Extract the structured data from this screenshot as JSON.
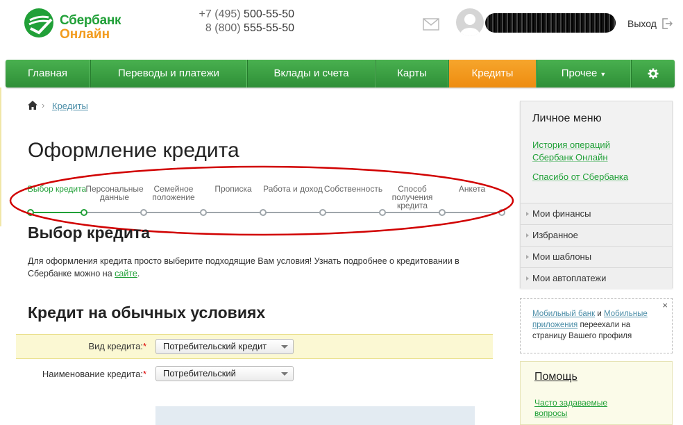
{
  "header": {
    "logo_line1": "Сбербанк",
    "logo_line2": "Онлайн",
    "phone1_prefix": "+7 (495)",
    "phone1_number": "500-55-50",
    "phone2_prefix": "8 (800)",
    "phone2_number": "555-55-50",
    "logout_label": "Выход"
  },
  "nav": {
    "items": [
      {
        "label": "Главная"
      },
      {
        "label": "Переводы и платежи"
      },
      {
        "label": "Вклады и счета"
      },
      {
        "label": "Карты"
      },
      {
        "label": "Кредиты"
      },
      {
        "label": "Прочее"
      }
    ],
    "active": "Кредиты"
  },
  "breadcrumb": {
    "item": "Кредиты"
  },
  "page_title": "Оформление кредита",
  "steps": [
    {
      "label": "Выбор кредита"
    },
    {
      "label": "Персональные данные"
    },
    {
      "label": "Семейное положение"
    },
    {
      "label": "Прописка"
    },
    {
      "label": "Работа и доход"
    },
    {
      "label": "Собственность"
    },
    {
      "label": "Способ получения кредита"
    },
    {
      "label": "Анкета"
    }
  ],
  "section_title": "Выбор кредита",
  "intro": {
    "text": "Для оформления кредита просто выберите подходящие Вам условия! Узнать подробнее о кредитовании в Сбербанке можно на ",
    "link": "сайте",
    "end": "."
  },
  "section2_title": "Кредит на обычных условиях",
  "form": {
    "credit_type_label": "Вид кредита:",
    "credit_type_value": "Потребительский кредит",
    "credit_name_label": "Наименование кредита:",
    "credit_name_value": "Потребительский",
    "required_mark": "*"
  },
  "sidebar": {
    "title": "Личное меню",
    "link1": "История операций Сбербанк Онлайн",
    "link2": "Спасибо от Сбербанка",
    "items": [
      {
        "label": "Мои финансы"
      },
      {
        "label": "Избранное"
      },
      {
        "label": "Мои шаблоны"
      },
      {
        "label": "Мои автоплатежи"
      }
    ]
  },
  "notice": {
    "close": "×",
    "link1": "Мобильный банк",
    "and": " и ",
    "link2": "Мобильные приложения",
    "rest": " переехали на страницу Вашего профиля"
  },
  "help": {
    "title": "Помощь",
    "link": "Часто задаваемые вопросы"
  },
  "colors": {
    "brand_green": "#21a038",
    "brand_orange": "#f29b1d",
    "annotation_red": "#d10000"
  }
}
